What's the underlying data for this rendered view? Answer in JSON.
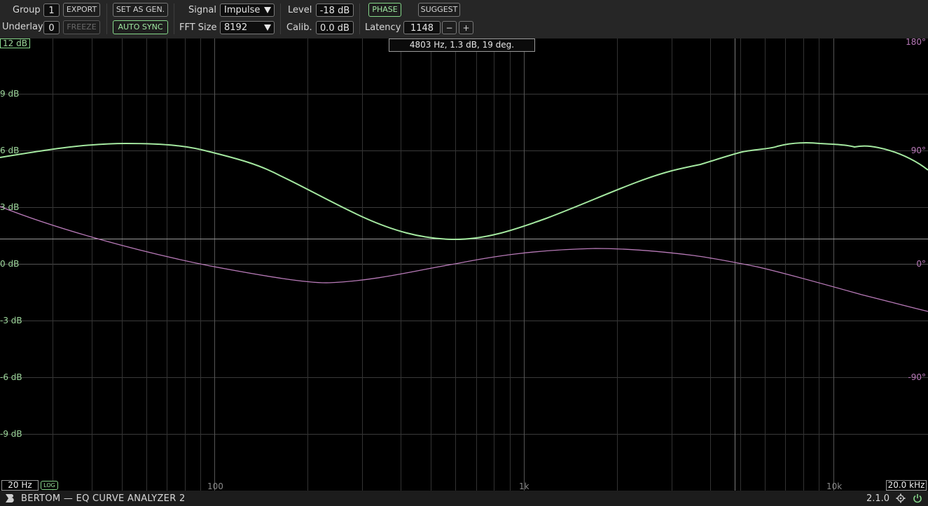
{
  "toolbar": {
    "group_label": "Group",
    "group_value": "1",
    "export_label": "EXPORT",
    "underlay_label": "Underlay",
    "underlay_value": "0",
    "freeze_label": "FREEZE",
    "set_as_gen_label": "SET AS GEN.",
    "auto_sync_label": "AUTO SYNC",
    "signal_label": "Signal",
    "signal_value": "Impulse",
    "fft_label": "FFT Size",
    "fft_value": "8192",
    "level_label": "Level",
    "level_value": "-18 dB",
    "calib_label": "Calib.",
    "calib_value": "0.0 dB",
    "phase_label": "PHASE",
    "suggest_label": "SUGGEST",
    "latency_label": "Latency",
    "latency_value": "1148",
    "minus_label": "−",
    "plus_label": "+"
  },
  "graph": {
    "db_labels": [
      "12 dB",
      "9 dB",
      "6 dB",
      "3 dB",
      "0 dB",
      "-3 dB",
      "-6 dB",
      "-9 dB"
    ],
    "phase_labels": [
      "180°",
      "90°",
      "0°",
      "-90°"
    ],
    "x_labels": [
      "100",
      "1k",
      "10k"
    ],
    "tooltip": "4803 Hz, 1.3 dB, 19 deg.",
    "min_freq": "20 Hz",
    "max_freq": "20.0 kHz",
    "log_badge": "LOG",
    "colors": {
      "magnitude": "#a4e8a0",
      "phase": "#b87ab8",
      "grid": "#3a3a3a",
      "crosshair": "#9a9a9a"
    }
  },
  "status": {
    "app_title": "BERTOM — EQ CURVE ANALYZER 2",
    "version": "2.1.0",
    "icons": [
      "bertom-logo-icon",
      "gear-icon",
      "power-icon"
    ]
  }
}
